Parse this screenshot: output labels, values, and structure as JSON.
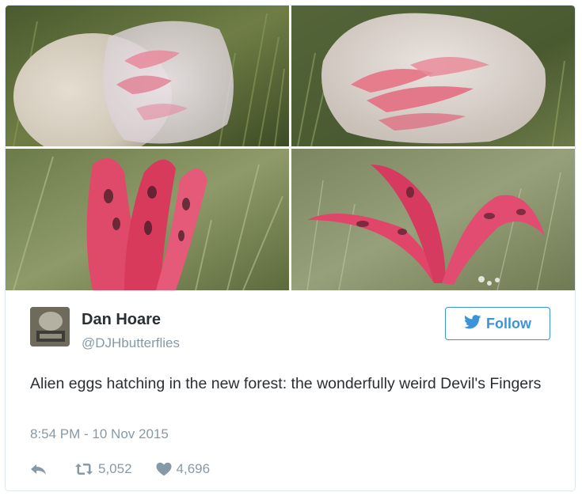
{
  "tweet": {
    "author": {
      "name": "Dan Hoare",
      "handle": "@DJHbutterflies"
    },
    "follow_label": "Follow",
    "text": "Alien eggs hatching in the new forest: the wonderfully weird Devil's Fingers",
    "timestamp": "8:54 PM - 10 Nov 2015",
    "retweets": "5,052",
    "likes": "4,696"
  },
  "colors": {
    "accent": "#3b94d9",
    "text": "#292f33",
    "muted": "#8899a6"
  },
  "icons": {
    "reply": "reply-icon",
    "retweet": "retweet-icon",
    "like": "heart-icon",
    "follow": "twitter-bird-icon"
  }
}
